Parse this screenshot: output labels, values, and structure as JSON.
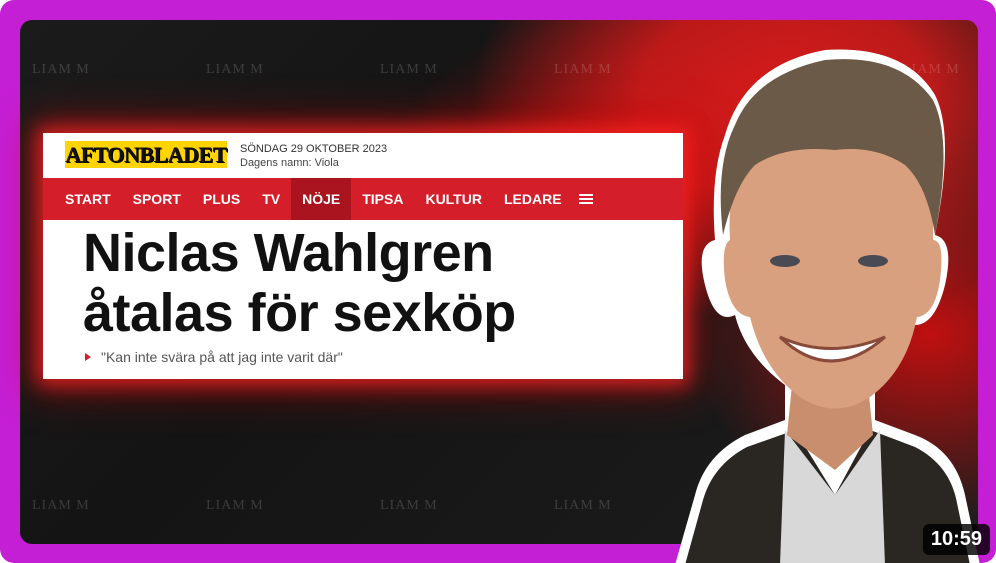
{
  "watermark": "LIAM M",
  "article": {
    "logo": "AFTONBLADET",
    "date": "SÖNDAG 29 OKTOBER 2023",
    "namnsdag": "Dagens namn: Viola",
    "nav": [
      "START",
      "SPORT",
      "PLUS",
      "TV",
      "NÖJE",
      "TIPSA",
      "KULTUR",
      "LEDARE"
    ],
    "active_nav": "NÖJE",
    "headline_line1": "Niclas Wahlgren",
    "headline_line2": "åtalas för sexköp",
    "subheading": "\"Kan inte svära på att jag inte varit där\""
  },
  "video": {
    "duration": "10:59"
  },
  "colors": {
    "frame": "#c51fd6",
    "nav_red": "#d41f2b",
    "logo_yellow": "#ffd400"
  }
}
